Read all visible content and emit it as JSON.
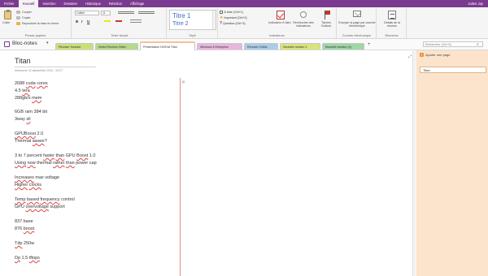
{
  "menubar": {
    "tabs": [
      "Fichier",
      "Accueil",
      "Insertion",
      "Dessiner",
      "Historique",
      "Révision",
      "Affichage"
    ],
    "active_index": 1,
    "user": "Julien Jay"
  },
  "ribbon": {
    "clipboard": {
      "paste_label": "Coller",
      "cut_label": "Couper",
      "copy_label": "Copier",
      "format_painter_label": "Reproduire la mise en forme",
      "group_label": "Presse-papiers"
    },
    "basic_text": {
      "font_name": "Calibri",
      "font_size": "11",
      "bold": "B",
      "italic": "I",
      "underline": "U",
      "group_label": "Texte simple"
    },
    "styles": {
      "heading1": "Titre 1",
      "heading2": "Titre 2",
      "group_label": "Style"
    },
    "tags": {
      "todo": "À faire (Ctrl+1)",
      "important": "Important (Ctrl+2)",
      "question": "Question (Ctrl+3)",
      "todo_tag_label": "Indicateur À faire",
      "find_tags_label": "Rechercher des indicateurs",
      "outlook_tasks_label": "Tâches Outlook",
      "group_label": "Indicateurs"
    },
    "email": {
      "send_label": "Envoyer la page par courrier électronique",
      "group_label": "Courrier électronique"
    },
    "meetings": {
      "details_label": "Détails de la réunion",
      "group_label": "Réunions"
    }
  },
  "notebook": {
    "name": "Bloc-notes",
    "sections": [
      {
        "label": "Réunion Youtube",
        "color": "#c9e07a"
      },
      {
        "label": "Notes Réunion Vidéo",
        "color": "#b6d98a"
      },
      {
        "label": "Présentation NVIDIA Titan",
        "color": "#f6c28b"
      },
      {
        "label": "Windows 8 Entreprise",
        "color": "#e7b6dd"
      },
      {
        "label": "Réunion Chibis",
        "color": "#a9cde8"
      },
      {
        "label": "Nouvelle section 1",
        "color": "#d9e37c"
      },
      {
        "label": "Nouvelle section (4)",
        "color": "#9fd6a6"
      }
    ],
    "active_section_index": 2,
    "add_tab_symbol": "+",
    "search_placeholder": "Rechercher (Ctrl+E)"
  },
  "page": {
    "title": "Titan",
    "date": "dimanche 22 septembre 2013",
    "time": "10:27",
    "margin_mark": "|0",
    "lines": [
      [
        [
          "2688 "
        ],
        [
          "cuda",
          true
        ],
        [
          " "
        ],
        [
          "cores",
          true
        ]
      ],
      [
        [
          "4.5 "
        ],
        [
          "tera",
          true
        ]
      ],
      [
        [
          "288gb/s "
        ],
        [
          "mem",
          true
        ]
      ],
      [
        [
          "6GB ram 384 bit"
        ]
      ],
      [
        [
          "3way "
        ],
        [
          "sli",
          true
        ]
      ],
      [
        [
          "GPUBoost",
          true
        ],
        [
          " 2.0"
        ]
      ],
      [
        [
          "Thermal "
        ],
        [
          "aware",
          true
        ],
        [
          "?"
        ]
      ],
      [
        [
          "3 to 7 percent "
        ],
        [
          "faster",
          true
        ],
        [
          " "
        ],
        [
          "than",
          true
        ],
        [
          " GPU "
        ],
        [
          "Boost",
          true
        ],
        [
          " 1.0"
        ]
      ],
      [
        [
          "Using",
          true
        ],
        [
          " "
        ],
        [
          "now",
          true
        ],
        [
          " thermal "
        ],
        [
          "rather",
          true
        ],
        [
          " "
        ],
        [
          "than",
          true
        ],
        [
          " power cap"
        ]
      ],
      [
        [
          "Increases",
          true
        ],
        [
          " max voltage"
        ]
      ],
      [
        [
          "Higher",
          true
        ],
        [
          " "
        ],
        [
          "clocks",
          true
        ]
      ],
      [
        [
          "Temp",
          true
        ],
        [
          " "
        ],
        [
          "based",
          true
        ],
        [
          " "
        ],
        [
          "frequency",
          true
        ],
        [
          " control"
        ]
      ],
      [
        [
          "GPU "
        ],
        [
          "overvoltage",
          true
        ],
        [
          " support"
        ]
      ],
      [
        [
          "837 base"
        ]
      ],
      [
        [
          "876 "
        ],
        [
          "boost",
          true
        ]
      ],
      [
        [
          "Tdp",
          true
        ],
        [
          " 250w"
        ]
      ],
      [
        [
          "Dp",
          true
        ],
        [
          " 1.5 "
        ],
        [
          "tflops",
          true
        ]
      ]
    ]
  },
  "pages_panel": {
    "add_page_label": "Ajouter une page",
    "pages": [
      "Titan"
    ]
  },
  "colors": {
    "accent": "#7a3a8f",
    "pages_panel_bg": "#fbe3cc",
    "red_margin": "#e58a8a"
  },
  "icons": [
    "paste-icon",
    "cut-icon",
    "copy-icon",
    "format-painter-icon",
    "todo-tag-icon",
    "find-tags-icon",
    "outlook-tasks-icon",
    "email-page-icon",
    "meeting-details-icon",
    "notebook-icon",
    "search-icon",
    "expand-icon",
    "add-page-icon"
  ]
}
